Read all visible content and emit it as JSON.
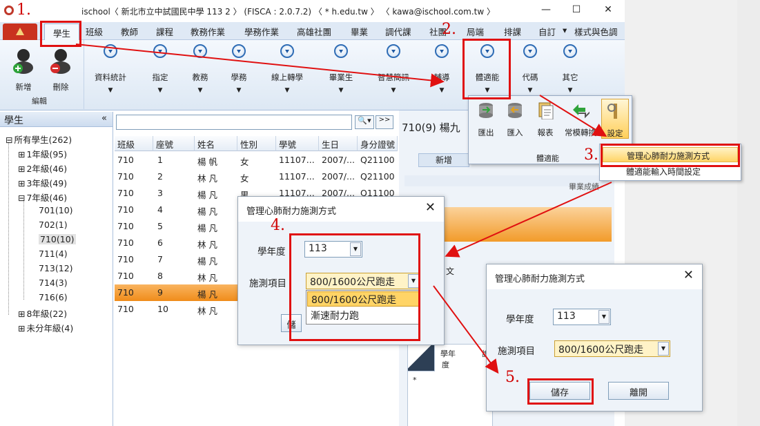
{
  "window": {
    "title": "ischool〈 新北市立中試國民中學 113 2 〉 (FISCA : 2.0.7.2) 〈 * h.edu.tw 〉 〈 kawa@ischool.com.tw 〉",
    "min": "—",
    "max": "☐",
    "close": "✕"
  },
  "tabs": [
    "學生",
    "班級",
    "教師",
    "課程",
    "教務作業",
    "學務作業",
    "高雄社團",
    "畢業",
    "調代課",
    "社團",
    "局端",
    "排課",
    "自訂",
    "▾",
    "樣式與色調"
  ],
  "ribbon": {
    "add_label": "新增",
    "delete_label": "刪除",
    "edit_group_label": "編輯",
    "buttons": [
      "資料統計",
      "指定",
      "教務",
      "學務",
      "線上轉學",
      "畢業生",
      "智慧簡訊",
      "輔導",
      "體適能",
      "代碼",
      "其它"
    ]
  },
  "left": {
    "header": "學生",
    "collapse": "«",
    "tree": [
      {
        "label": "所有學生(262)",
        "exp": "⊟"
      },
      {
        "label": "1年級(95)",
        "exp": "⊞"
      },
      {
        "label": "2年級(46)",
        "exp": "⊞"
      },
      {
        "label": "3年級(49)",
        "exp": "⊞"
      },
      {
        "label": "7年級(46)",
        "exp": "⊟"
      },
      {
        "label": "701(10)"
      },
      {
        "label": "702(1)"
      },
      {
        "label": "710(10)"
      },
      {
        "label": "711(4)"
      },
      {
        "label": "713(12)"
      },
      {
        "label": "714(3)"
      },
      {
        "label": "716(6)"
      },
      {
        "label": "8年級(22)",
        "exp": "⊞"
      },
      {
        "label": "未分年級(4)",
        "exp": "⊞"
      }
    ]
  },
  "grid": {
    "search_icon": "🔍▾",
    "next": ">>",
    "columns": [
      "班級",
      "座號",
      "姓名",
      "性別",
      "學號",
      "生日",
      "身分證號"
    ],
    "rows": [
      [
        "710",
        "1",
        "楊 帆",
        "女",
        "11107...",
        "2007/...",
        "Q21100"
      ],
      [
        "710",
        "2",
        "林 凡",
        "女",
        "11107...",
        "2007/...",
        "Q21100"
      ],
      [
        "710",
        "3",
        "楊 凡",
        "男",
        "11107...",
        "2007/...",
        "Q11100"
      ],
      [
        "710",
        "4",
        "楊 凡",
        "",
        "",
        "",
        ""
      ],
      [
        "710",
        "5",
        "楊 凡",
        "",
        "",
        "",
        ""
      ],
      [
        "710",
        "6",
        "林 凡",
        "",
        "",
        "",
        ""
      ],
      [
        "710",
        "7",
        "楊 凡",
        "",
        "",
        "",
        ""
      ],
      [
        "710",
        "8",
        "林 凡",
        "",
        "",
        "",
        ""
      ],
      [
        "710",
        "9",
        "楊 凡",
        "",
        "",
        "",
        ""
      ],
      [
        "710",
        "10",
        "林 凡",
        "",
        "",
        "",
        ""
      ]
    ],
    "selected_index": 8
  },
  "detail": {
    "student_title": "710(9) 楊九",
    "subtab": "新增",
    "section_right": "畢業成績",
    "text_snip": "文",
    "table_h1": "學年",
    "table_h1b": "度",
    "table_h2": "說",
    "star": "*"
  },
  "fitness_panel": {
    "buttons": [
      "匯出",
      "匯入",
      "報表",
      "常模轉換",
      "設定"
    ],
    "group_label": "體適能",
    "menu": [
      "管理心肺耐力施測方式",
      "體適能輸入時間設定"
    ]
  },
  "dialog1": {
    "title": "管理心肺耐力施測方式",
    "close": "✕",
    "year_label": "學年度",
    "year_value": "113",
    "item_label": "施測項目",
    "item_value": "800/1600公尺跑走",
    "options": [
      "800/1600公尺跑走",
      "漸速耐力跑"
    ],
    "partial_button": "儲"
  },
  "dialog2": {
    "title": "管理心肺耐力施測方式",
    "close": "✕",
    "year_label": "學年度",
    "year_value": "113",
    "item_label": "施測項目",
    "item_value": "800/1600公尺跑走",
    "save_label": "儲存",
    "leave_label": "離開"
  },
  "steps": [
    "1.",
    "2.",
    "3.",
    "4.",
    "5."
  ],
  "colors": {
    "accent_red": "#e01010",
    "selection_orange": "#f08c1a",
    "highlight_yellow": "#ffd466"
  }
}
